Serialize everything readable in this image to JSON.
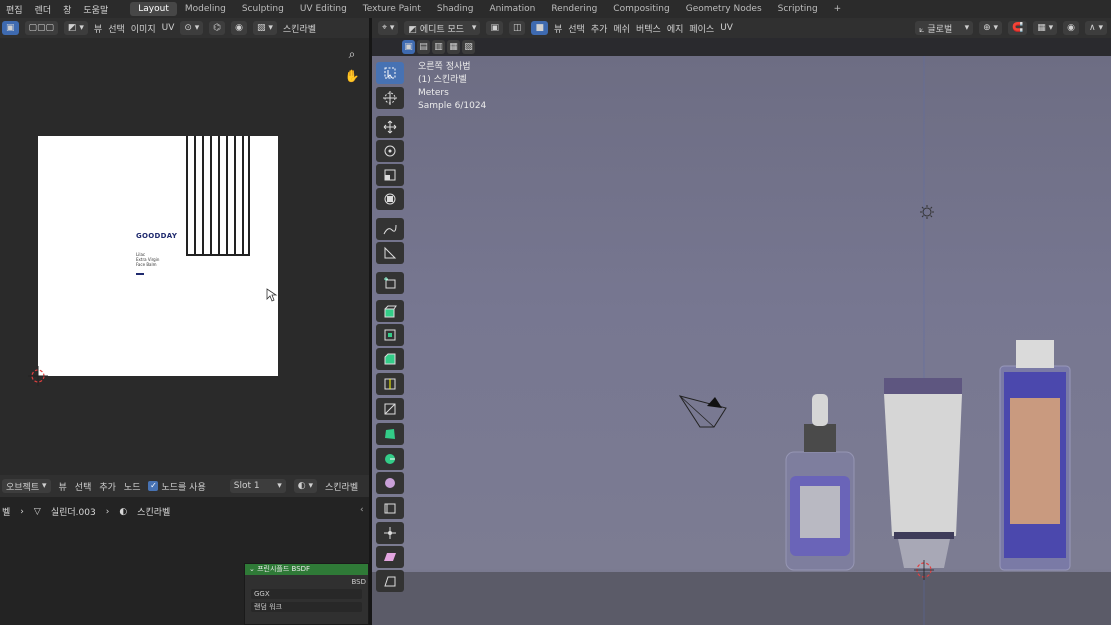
{
  "menu": {
    "items": [
      "편집",
      "렌더",
      "창",
      "도움말"
    ]
  },
  "workspaces": {
    "tabs": [
      "Layout",
      "Modeling",
      "Sculpting",
      "UV Editing",
      "Texture Paint",
      "Shading",
      "Animation",
      "Rendering",
      "Compositing",
      "Geometry Nodes",
      "Scripting"
    ],
    "add": "+"
  },
  "image_editor": {
    "header": {
      "view": "뷰",
      "select": "선택",
      "image": "이미지",
      "uv": "UV",
      "image_name": "스킨라벨"
    },
    "label": {
      "brand": "GOODDAY",
      "line1": "Lilac",
      "line2": "Extra Virgin",
      "line3": "Face Balm"
    }
  },
  "node_editor": {
    "header": {
      "object": "오브젝트",
      "view": "뷰",
      "select": "선택",
      "add": "추가",
      "node": "노드",
      "use_nodes": "노드를 사용",
      "slot": "Slot 1",
      "material": "스킨라벨"
    },
    "breadcrumb": {
      "first": "벨",
      "mesh": "실린더.003",
      "material": "스킨라벨"
    },
    "node": {
      "title": "프린시플드 BSDF",
      "output": "BSD",
      "distribution": "GGX",
      "subsurface": "랜덤 워크"
    }
  },
  "viewport": {
    "header": {
      "mode": "에디트 모드",
      "view": "뷰",
      "select": "선택",
      "add": "추가",
      "mesh": "메쉬",
      "vertex": "버텍스",
      "edge": "에지",
      "face": "페이스",
      "uv": "UV",
      "orientation": "글로벌"
    },
    "overlay": {
      "view_name": "오른쪽 정사법",
      "object_name": "(1) 스킨라벨",
      "units": "Meters",
      "sample": "Sample 6/1024"
    }
  },
  "colors": {
    "accent": "#4772b3",
    "viewport_bg": "#777791",
    "bottle_purple": "#6a64b8",
    "label_peach": "#c99a7f",
    "node_header": "#2f7a37"
  },
  "icons": [
    "select-box-icon",
    "cursor-icon",
    "move-icon",
    "rotate-icon",
    "scale-icon",
    "transform-icon",
    "annotate-icon",
    "measure-icon",
    "add-cube-icon",
    "extrude-icon",
    "inset-icon",
    "bevel-icon",
    "loop-cut-icon",
    "knife-icon",
    "poly-build-icon",
    "spin-icon",
    "smooth-icon",
    "edge-slide-icon",
    "shrink-fatten-icon",
    "shear-icon",
    "rip-icon"
  ]
}
